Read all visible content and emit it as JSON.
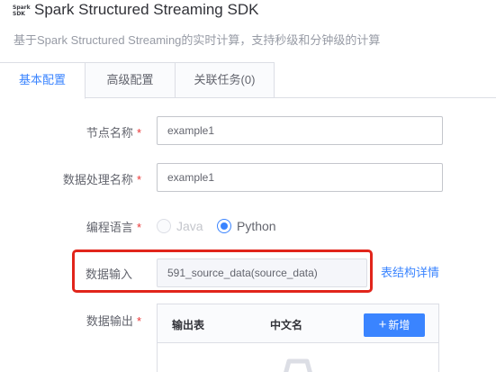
{
  "header": {
    "logo_text_line1": "Spark",
    "logo_text_line2": "SDK",
    "title": "Spark Structured Streaming SDK",
    "subtitle": "基于Spark Structured Streaming的实时计算，支持秒级和分钟级的计算"
  },
  "tabs": [
    {
      "label": "基本配置",
      "active": true
    },
    {
      "label": "高级配置",
      "active": false
    },
    {
      "label": "关联任务(0)",
      "active": false
    }
  ],
  "form": {
    "required_mark": "*",
    "node_name": {
      "label": "节点名称",
      "value": "example1"
    },
    "process_name": {
      "label": "数据处理名称",
      "value": "example1"
    },
    "language": {
      "label": "编程语言",
      "options": [
        {
          "label": "Java",
          "disabled": true,
          "checked": false
        },
        {
          "label": "Python",
          "disabled": false,
          "checked": true
        }
      ]
    },
    "data_input": {
      "label": "数据输入",
      "value": "591_source_data(source_data)",
      "link": "表结构详情"
    },
    "data_output": {
      "label": "数据输出",
      "columns": [
        "输出表",
        "中文名"
      ],
      "add_button": "新增",
      "add_icon": "plus-icon",
      "empty_icon": "empty-box-icon"
    }
  },
  "colors": {
    "accent": "#3a84ff",
    "highlight_border": "#e1251b",
    "required": "#ea3636"
  }
}
